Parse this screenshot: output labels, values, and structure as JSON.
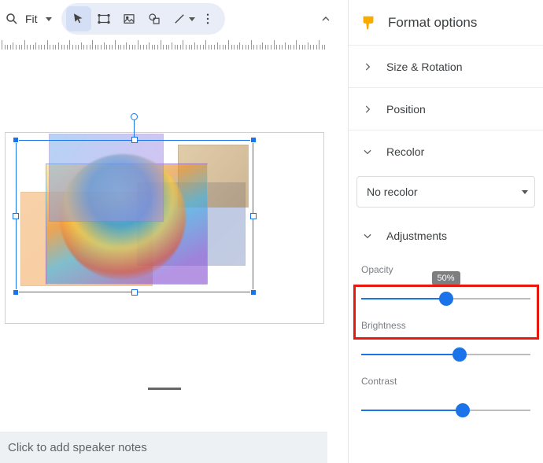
{
  "toolbar": {
    "zoom_value": "Fit"
  },
  "notes_placeholder": "Click to add speaker notes",
  "panel": {
    "title": "Format options",
    "sections": {
      "size_rotation": "Size & Rotation",
      "position": "Position",
      "recolor": "Recolor",
      "adjustments": "Adjustments"
    },
    "recolor_value": "No recolor",
    "sliders": {
      "opacity": {
        "label": "Opacity",
        "value_text": "50%",
        "percent": 50
      },
      "brightness": {
        "label": "Brightness",
        "percent": 58
      },
      "contrast": {
        "label": "Contrast",
        "percent": 60
      }
    }
  }
}
